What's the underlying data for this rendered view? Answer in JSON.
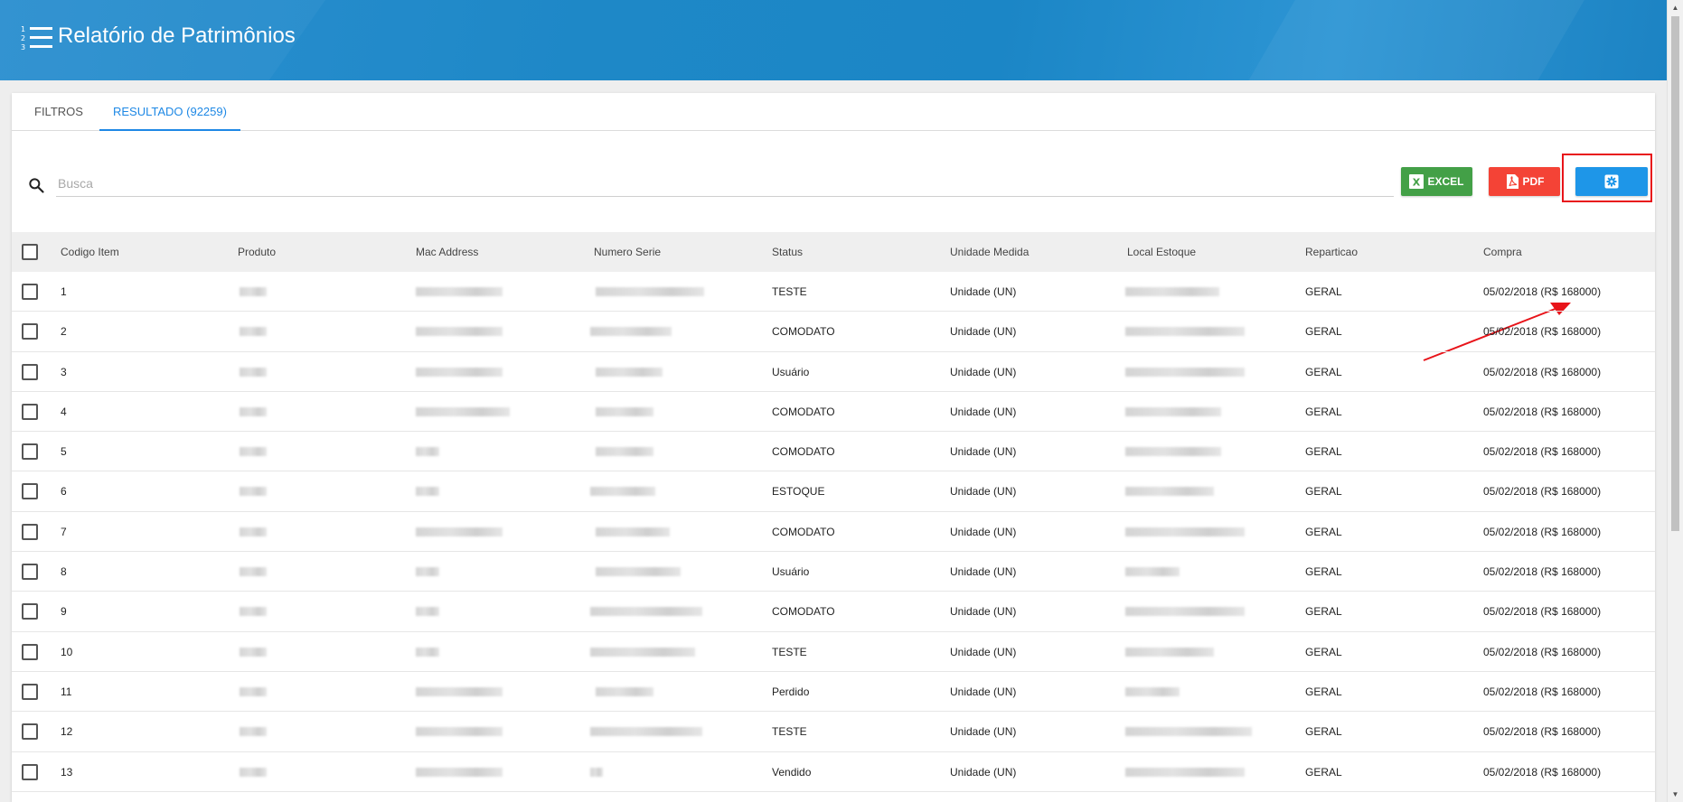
{
  "header": {
    "title": "Relatório de Patrimônios",
    "icon": "numbered-list-icon"
  },
  "tabs": [
    {
      "label": "FILTROS",
      "active": false
    },
    {
      "label": "RESULTADO (92259)",
      "active": true
    }
  ],
  "search": {
    "placeholder": "Busca",
    "value": ""
  },
  "actions": {
    "excel_label": "EXCEL",
    "pdf_label": "PDF",
    "settings_icon": "gear-icon"
  },
  "colors": {
    "header": "#1e88c7",
    "excel": "#43a047",
    "pdf": "#f44336",
    "settings": "#1e96e8",
    "accent": "#1e88e5",
    "highlight": "#e8141a"
  },
  "table": {
    "columns": [
      "Codigo Item",
      "Produto",
      "Mac Address",
      "Numero Serie",
      "Status",
      "Unidade Medida",
      "Local Estoque",
      "Reparticao",
      "Compra"
    ],
    "rows": [
      {
        "codigo": "1",
        "status": "TESTE",
        "unidade": "Unidade (UN)",
        "reparticao": "GERAL",
        "compra": "05/02/2018 (R$ 168000)"
      },
      {
        "codigo": "2",
        "status": "COMODATO",
        "unidade": "Unidade (UN)",
        "reparticao": "GERAL",
        "compra": "05/02/2018 (R$ 168000)"
      },
      {
        "codigo": "3",
        "status": "Usuário",
        "unidade": "Unidade (UN)",
        "reparticao": "GERAL",
        "compra": "05/02/2018 (R$ 168000)"
      },
      {
        "codigo": "4",
        "status": "COMODATO",
        "unidade": "Unidade (UN)",
        "reparticao": "GERAL",
        "compra": "05/02/2018 (R$ 168000)"
      },
      {
        "codigo": "5",
        "status": "COMODATO",
        "unidade": "Unidade (UN)",
        "reparticao": "GERAL",
        "compra": "05/02/2018 (R$ 168000)"
      },
      {
        "codigo": "6",
        "status": "ESTOQUE",
        "unidade": "Unidade (UN)",
        "reparticao": "GERAL",
        "compra": "05/02/2018 (R$ 168000)"
      },
      {
        "codigo": "7",
        "status": "COMODATO",
        "unidade": "Unidade (UN)",
        "reparticao": "GERAL",
        "compra": "05/02/2018 (R$ 168000)"
      },
      {
        "codigo": "8",
        "status": "Usuário",
        "unidade": "Unidade (UN)",
        "reparticao": "GERAL",
        "compra": "05/02/2018 (R$ 168000)"
      },
      {
        "codigo": "9",
        "status": "COMODATO",
        "unidade": "Unidade (UN)",
        "reparticao": "GERAL",
        "compra": "05/02/2018 (R$ 168000)"
      },
      {
        "codigo": "10",
        "status": "TESTE",
        "unidade": "Unidade (UN)",
        "reparticao": "GERAL",
        "compra": "05/02/2018 (R$ 168000)"
      },
      {
        "codigo": "11",
        "status": "Perdido",
        "unidade": "Unidade (UN)",
        "reparticao": "GERAL",
        "compra": "05/02/2018 (R$ 168000)"
      },
      {
        "codigo": "12",
        "status": "TESTE",
        "unidade": "Unidade (UN)",
        "reparticao": "GERAL",
        "compra": "05/02/2018 (R$ 168000)"
      },
      {
        "codigo": "13",
        "status": "Vendido",
        "unidade": "Unidade (UN)",
        "reparticao": "GERAL",
        "compra": "05/02/2018 (R$ 168000)"
      }
    ]
  }
}
